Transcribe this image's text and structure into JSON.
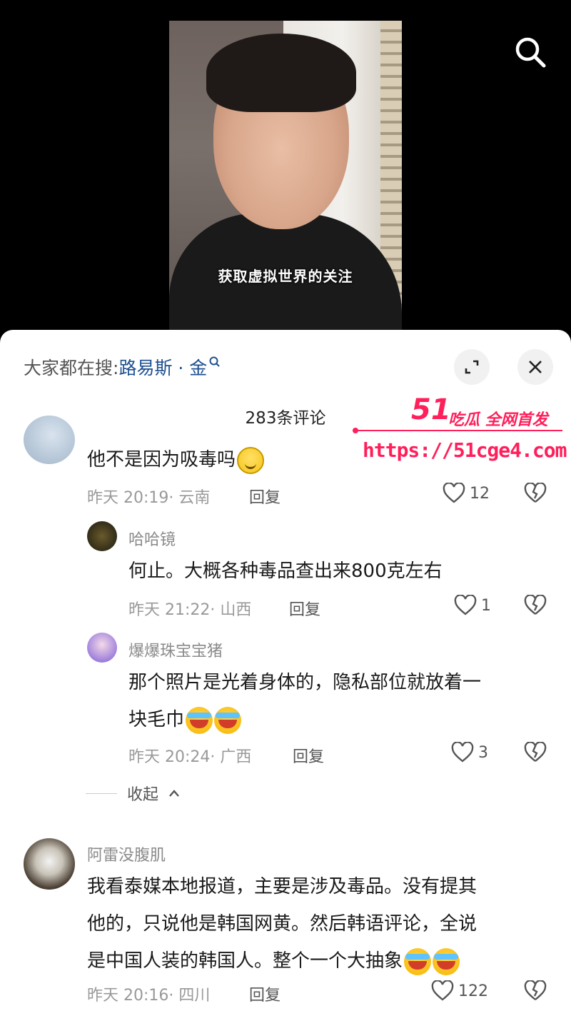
{
  "video": {
    "caption": "获取虚拟世界的关注"
  },
  "panel": {
    "trending_prefix": "大家都在搜:",
    "trending_term": "路易斯 · 金",
    "comment_count": "283条评论"
  },
  "watermark": {
    "logo_number": "51",
    "logo_text": "吃瓜 全网首发",
    "url": "https://51cge4.com"
  },
  "comments": [
    {
      "text": "他不是因为吸毒吗",
      "time": "昨天 20:19",
      "location": "云南",
      "likes": "12",
      "reply_label": "回复"
    },
    {
      "user": "哈哈镜",
      "text": "何止。大概各种毒品查出来800克左右",
      "time": "昨天 21:22",
      "location": "山西",
      "likes": "1",
      "reply_label": "回复"
    },
    {
      "user": "爆爆珠宝宝猪",
      "text_line1": "那个照片是光着身体的，隐私部位就放着一",
      "text_line2": "块毛巾",
      "time": "昨天 20:24",
      "location": "广西",
      "likes": "3",
      "reply_label": "回复"
    },
    {
      "user": "阿雷没腹肌",
      "text_line1": "我看泰媒本地报道，主要是涉及毒品。没有提其",
      "text_line2": "他的，只说他是韩国网黄。然后韩语评论，全说",
      "text_line3": "是中国人装的韩国人。整个一个大抽象",
      "time": "昨天 20:16",
      "location": "四川",
      "likes": "122",
      "reply_label": "回复"
    }
  ],
  "collapse_label": "收起",
  "colors": {
    "accent_link": "#1d4f91",
    "watermark": "#ff1f5a"
  }
}
